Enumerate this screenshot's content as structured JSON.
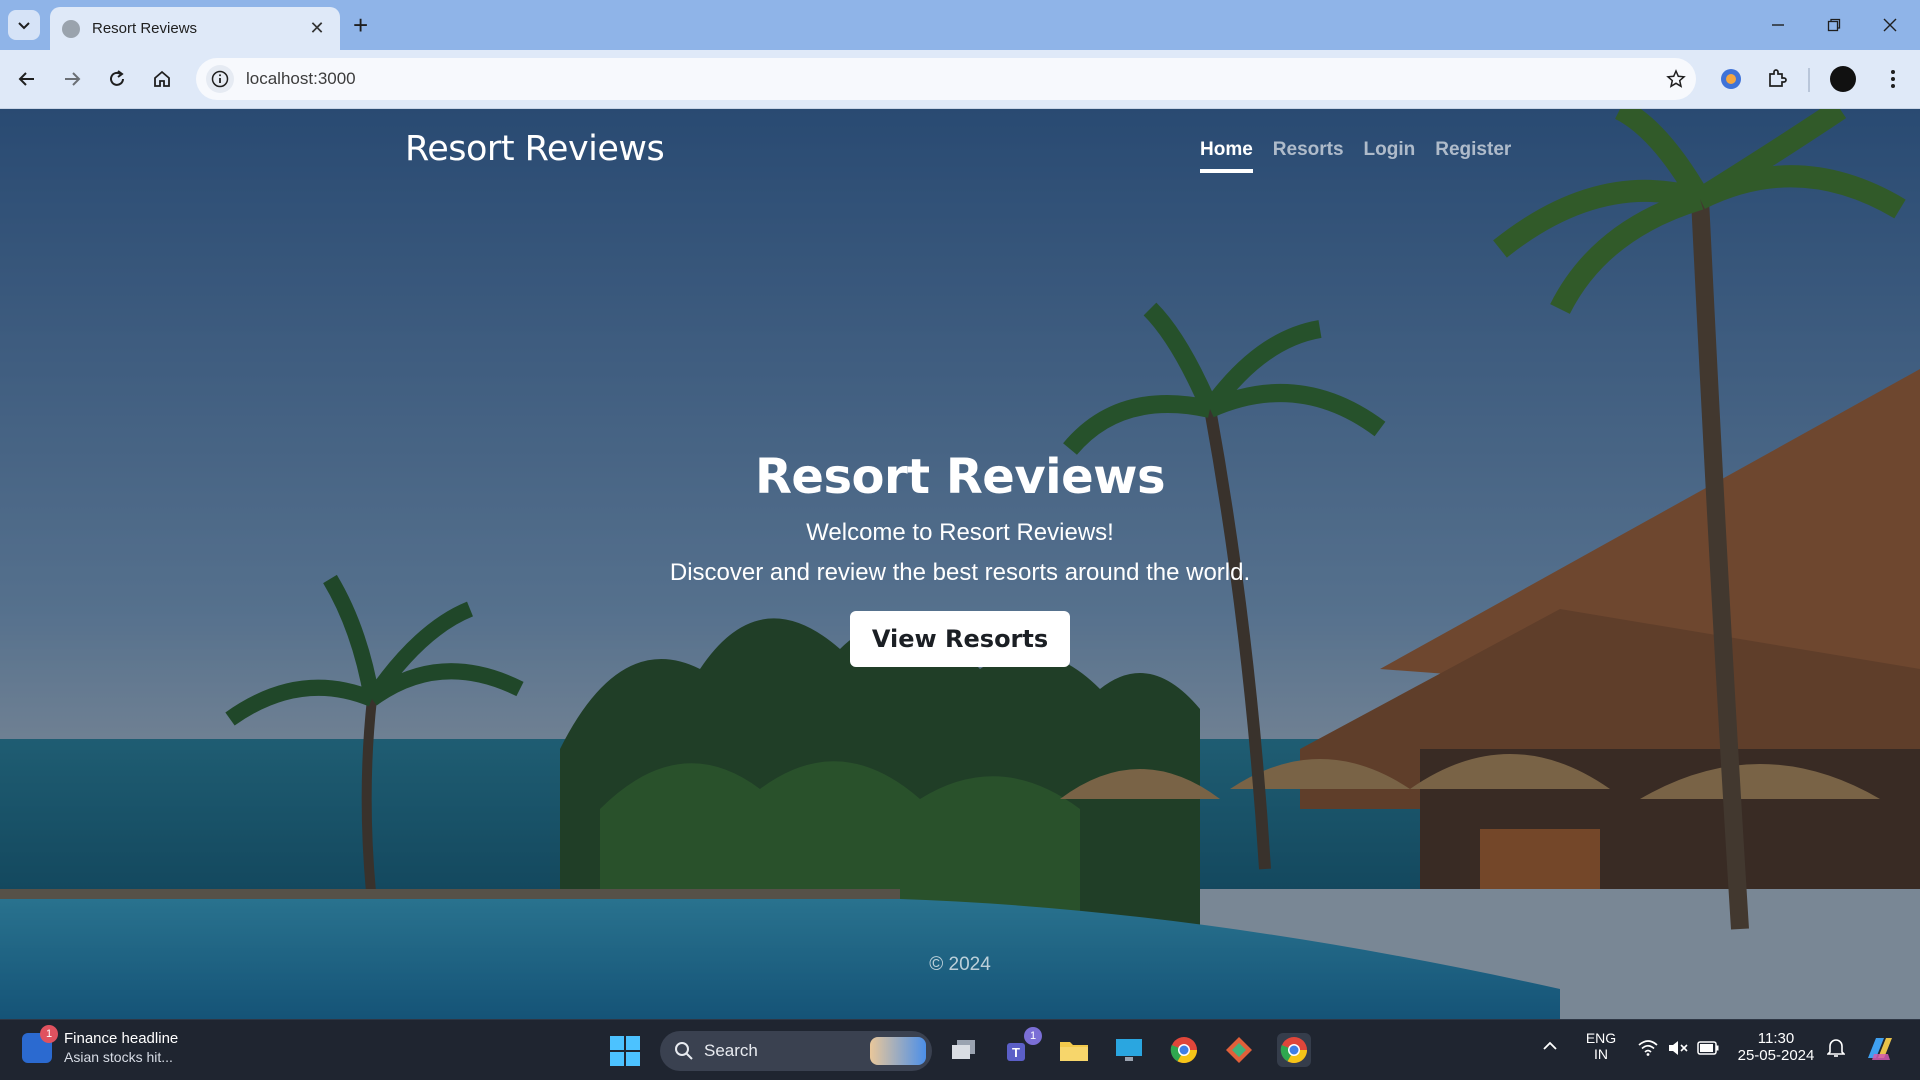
{
  "browser": {
    "tab_title": "Resort Reviews",
    "url": "localhost:3000"
  },
  "site": {
    "brand": "Resort Reviews",
    "nav": [
      {
        "label": "Home",
        "active": true
      },
      {
        "label": "Resorts",
        "active": false
      },
      {
        "label": "Login",
        "active": false
      },
      {
        "label": "Register",
        "active": false
      }
    ],
    "hero": {
      "title": "Resort Reviews",
      "subtitle": "Welcome to Resort Reviews!",
      "description": "Discover and review the best resorts around the world.",
      "cta_label": "View Resorts"
    },
    "footer": "© 2024"
  },
  "taskbar": {
    "widget": {
      "title": "Finance headline",
      "subtitle": "Asian stocks hit...",
      "badge": "1"
    },
    "search_label": "Search",
    "teams_badge": "1",
    "language": {
      "line1": "ENG",
      "line2": "IN"
    },
    "clock": {
      "time": "11:30",
      "date": "25-05-2024"
    }
  },
  "colors": {
    "tabstrip": "#8fb4e8",
    "toolbar": "#dfe9f8",
    "taskbar": "#1f2530",
    "cta_bg": "#ffffff"
  }
}
